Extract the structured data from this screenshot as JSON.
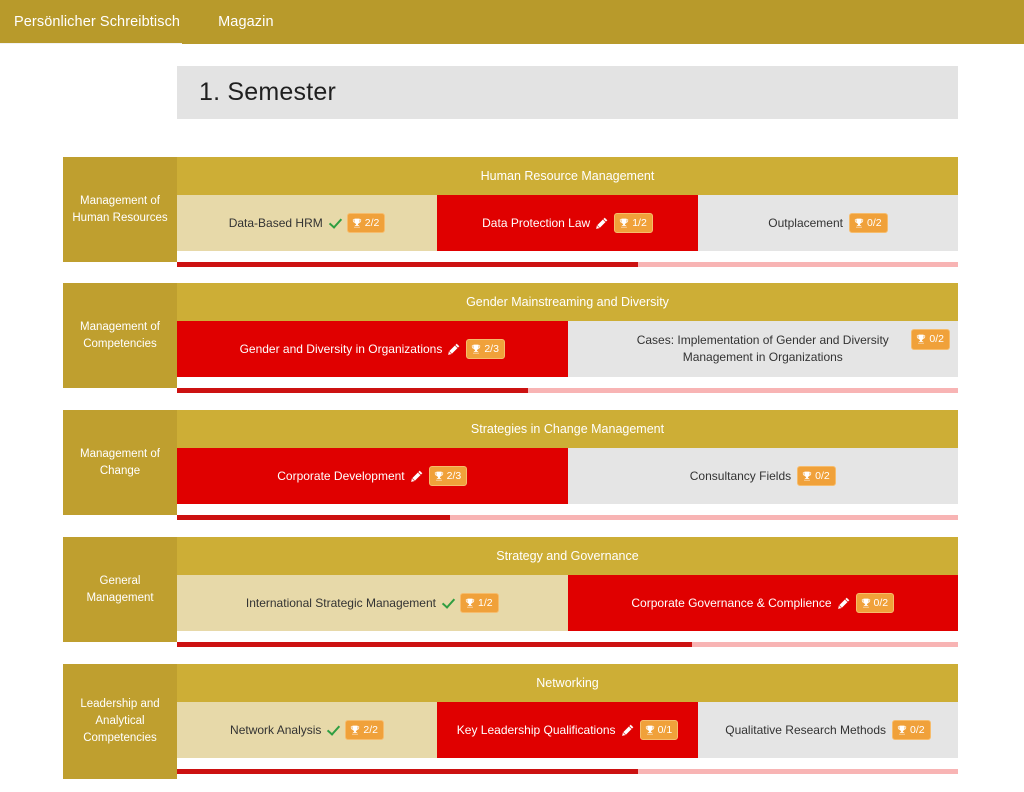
{
  "tabs": [
    {
      "label": "Persönlicher Schreibtisch",
      "active": true
    },
    {
      "label": "Magazin",
      "active": false
    }
  ],
  "semester": {
    "title": "1. Semester"
  },
  "colors": {
    "brand_gold": "#b89a2b",
    "module_title_gold": "#cdae36",
    "competency_gold": "#bf9f2f",
    "header_gray": "#e3e3e3",
    "course_done": "#e7d9a9",
    "course_active": "#e00000",
    "course_open": "#e5e5e5",
    "badge_orange": "#f0a13a",
    "progress_fill": "#cc1111",
    "progress_track": "#f8b4b4",
    "check_green": "#2f9e41"
  },
  "rows": [
    {
      "competency": "Management of Human Resources",
      "module_title": "Human Resource Management",
      "progress_percent": 59,
      "courses": [
        {
          "label": "Data-Based HRM",
          "state": "done",
          "icon": "check-icon",
          "badge": "2/2",
          "width_percent": 33.3,
          "multiline": false
        },
        {
          "label": "Data Protection Law",
          "state": "active",
          "icon": "pencil-icon",
          "badge": "1/2",
          "width_percent": 33.4,
          "multiline": false
        },
        {
          "label": "Outplacement",
          "state": "open",
          "icon": "none",
          "badge": "0/2",
          "width_percent": 33.3,
          "multiline": false
        }
      ]
    },
    {
      "competency": "Management of Competencies",
      "module_title": "Gender Mainstreaming and Diversity",
      "progress_percent": 45,
      "courses": [
        {
          "label": "Gender and Diversity in Organizations",
          "state": "active",
          "icon": "pencil-icon",
          "badge": "2/3",
          "width_percent": 50,
          "multiline": false
        },
        {
          "label": "Cases: Implementation of Gender and Diversity Management in Organizations",
          "state": "open",
          "icon": "none",
          "badge": "0/2",
          "width_percent": 50,
          "multiline": true
        }
      ]
    },
    {
      "competency": "Management of Change",
      "module_title": "Strategies in Change Management",
      "progress_percent": 35,
      "courses": [
        {
          "label": "Corporate Development",
          "state": "active",
          "icon": "pencil-icon",
          "badge": "2/3",
          "width_percent": 50,
          "multiline": false
        },
        {
          "label": "Consultancy Fields",
          "state": "open",
          "icon": "none",
          "badge": "0/2",
          "width_percent": 50,
          "multiline": false
        }
      ]
    },
    {
      "competency": "General Management",
      "module_title": "Strategy and Governance",
      "progress_percent": 66,
      "courses": [
        {
          "label": "International Strategic Management",
          "state": "done",
          "icon": "check-icon",
          "badge": "1/2",
          "width_percent": 50,
          "multiline": false
        },
        {
          "label": "Corporate Governance & Complience",
          "state": "active",
          "icon": "pencil-icon",
          "badge": "0/2",
          "width_percent": 50,
          "multiline": false
        }
      ]
    },
    {
      "competency": "Leadership and Analytical Competencies",
      "module_title": "Networking",
      "progress_percent": 59,
      "courses": [
        {
          "label": "Network Analysis",
          "state": "done",
          "icon": "check-icon",
          "badge": "2/2",
          "width_percent": 33.3,
          "multiline": false
        },
        {
          "label": "Key Leadership Qualifications",
          "state": "active",
          "icon": "pencil-icon",
          "badge": "0/1",
          "width_percent": 33.4,
          "multiline": false
        },
        {
          "label": "Qualitative Research Methods",
          "state": "open",
          "icon": "none",
          "badge": "0/2",
          "width_percent": 33.3,
          "multiline": false
        }
      ]
    }
  ]
}
